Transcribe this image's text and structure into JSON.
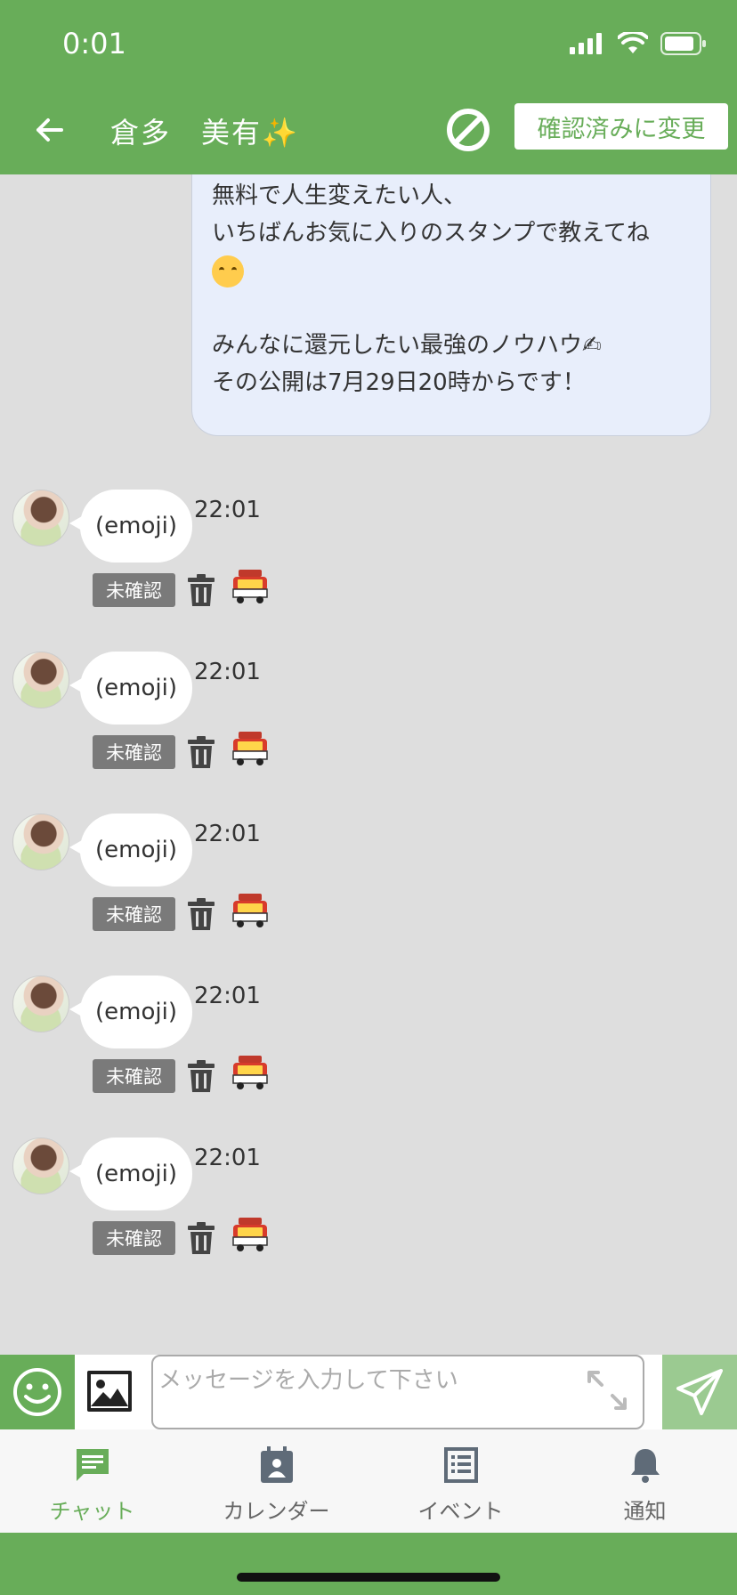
{
  "status_bar": {
    "time": "0:01"
  },
  "header": {
    "title": "倉多　美有✨",
    "confirm_label": "確認済みに変更"
  },
  "sent_message": {
    "lines": [
      "無料で人生変えたい人、",
      "いちばんお気に入りのスタンプで教えてね",
      "",
      "",
      "みんなに還元したい最強のノウハウ✍",
      "その公開は7月29日20時からです！"
    ],
    "emoji_icon": "smiling-face-with-hearts-icon"
  },
  "messages": [
    {
      "text": "(emoji)",
      "time": "22:01",
      "status": "未確認"
    },
    {
      "text": "(emoji)",
      "time": "22:01",
      "status": "未確認"
    },
    {
      "text": "(emoji)",
      "time": "22:01",
      "status": "未確認"
    },
    {
      "text": "(emoji)",
      "time": "22:01",
      "status": "未確認"
    },
    {
      "text": "(emoji)",
      "time": "22:01",
      "status": "未確認"
    }
  ],
  "report_icon_label": "通報",
  "input": {
    "placeholder": "メッセージを入力して下さい",
    "value": ""
  },
  "tabs": [
    {
      "label": "チャット",
      "icon": "chat-icon",
      "active": true
    },
    {
      "label": "カレンダー",
      "icon": "calendar-icon",
      "active": false
    },
    {
      "label": "イベント",
      "icon": "event-list-icon",
      "active": false
    },
    {
      "label": "通知",
      "icon": "bell-icon",
      "active": false
    }
  ],
  "colors": {
    "brand_green": "#68ad59",
    "send_green": "#9bca91",
    "chat_background": "#dedede",
    "sent_bubble": "#e8eefb"
  }
}
